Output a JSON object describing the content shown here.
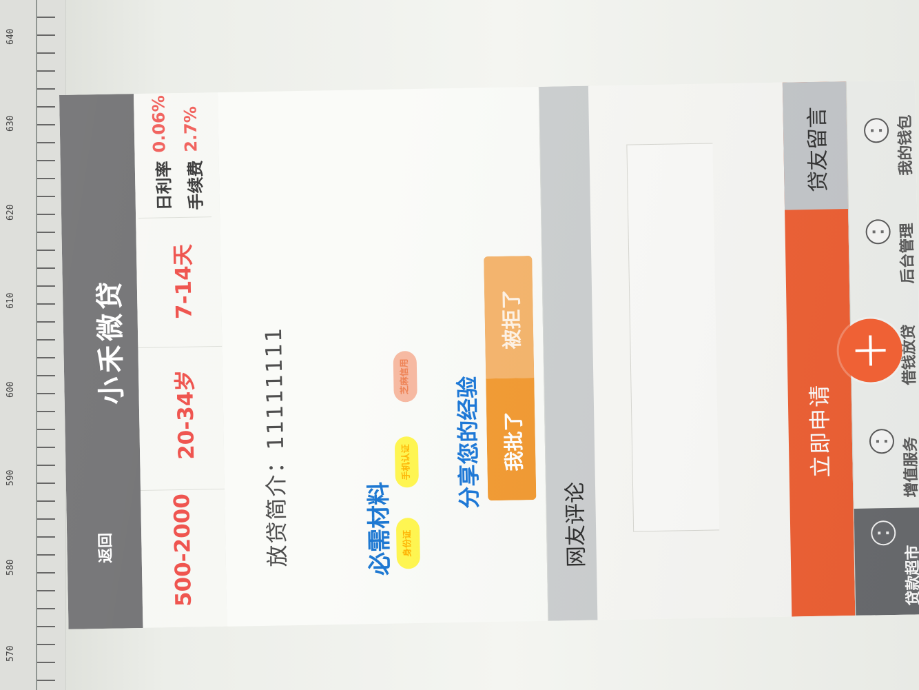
{
  "ruler": {
    "labels": [
      "570",
      "580",
      "590",
      "600",
      "610",
      "620",
      "630",
      "640"
    ]
  },
  "header": {
    "back_label": "返回",
    "title": "小禾微贷"
  },
  "stats": {
    "amount_range": "500-2000",
    "age_range": "20-34岁",
    "term_range": "7-14天",
    "daily_rate_label": "日利率",
    "daily_rate_value": "0.06%",
    "fee_label": "手续费",
    "fee_value": "2.7%"
  },
  "details": {
    "description": "放贷简介：11111111",
    "materials_title": "必需材料",
    "materials": [
      "身份证",
      "手机认证",
      "芝麻信用"
    ],
    "share_title": "分享您的经验",
    "outcomes": {
      "approved": "我批了",
      "rejected": "被拒了"
    }
  },
  "comments": {
    "title": "网友评论"
  },
  "actions": {
    "apply": "立即申请",
    "message": "贷友留言"
  },
  "bottom_nav": {
    "items": [
      {
        "label": "贷款超市",
        "icon": "market-icon"
      },
      {
        "label": "增值服务",
        "icon": "service-icon"
      },
      {
        "label": "借钱放贷",
        "icon": "plus-icon"
      },
      {
        "label": "后台管理",
        "icon": "admin-icon"
      },
      {
        "label": "我的钱包",
        "icon": "wallet-icon"
      }
    ]
  },
  "colors": {
    "header_gray": "#6f6f71",
    "accent_orange": "#ef6135",
    "blue_text": "#1875d1",
    "red_text": "#ee4c46"
  }
}
